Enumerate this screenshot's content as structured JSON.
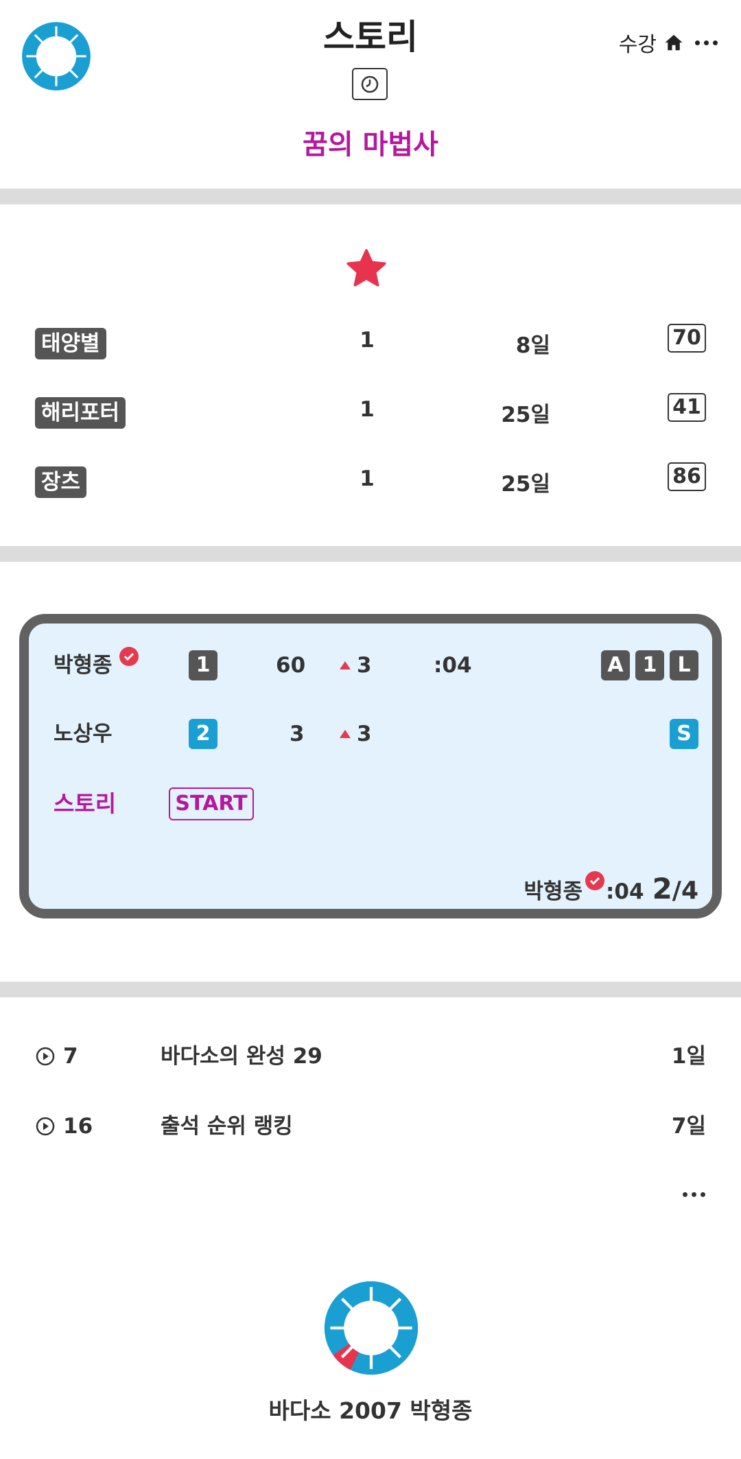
{
  "header": {
    "title": "스토리",
    "lesson": "꿈의 마법사",
    "enroll_label": "수강"
  },
  "ranking": [
    {
      "name": "태양별",
      "count": "1",
      "days": "8일",
      "score": "70"
    },
    {
      "name": "해리포터",
      "count": "1",
      "days": "25일",
      "score": "41"
    },
    {
      "name": "장츠",
      "count": "1",
      "days": "25일",
      "score": "86"
    }
  ],
  "board": {
    "player1": {
      "name": "박형종",
      "rank": "1",
      "score": "60",
      "change": "3",
      "time": ":04",
      "chips": [
        "A",
        "1",
        "L"
      ]
    },
    "player2": {
      "name": "노상우",
      "rank": "2",
      "score": "3",
      "change": "3",
      "chip": "S"
    },
    "story_label": "스토리",
    "start_label": "START",
    "footer_name": "박형종",
    "footer_time": ":04",
    "footer_progress_current": "2",
    "footer_progress_total": "/4"
  },
  "list": [
    {
      "num": "7",
      "title": "바다소의 완성 29",
      "days": "1일"
    },
    {
      "num": "16",
      "title": "출석 순위 랭킹",
      "days": "7일"
    }
  ],
  "footer": {
    "text": "바다소 2007 박형종"
  },
  "colors": {
    "accent_magenta": "#b5179e",
    "brand_blue": "#1a9fd3",
    "star_red": "#e8334f",
    "card_bg": "#e3f2fd",
    "card_border": "#616161"
  },
  "icons": [
    "ring-logo-icon",
    "clock-icon",
    "home-icon",
    "more-icon",
    "star-icon",
    "check-badge-icon",
    "triangle-up-icon",
    "play-circle-icon"
  ]
}
